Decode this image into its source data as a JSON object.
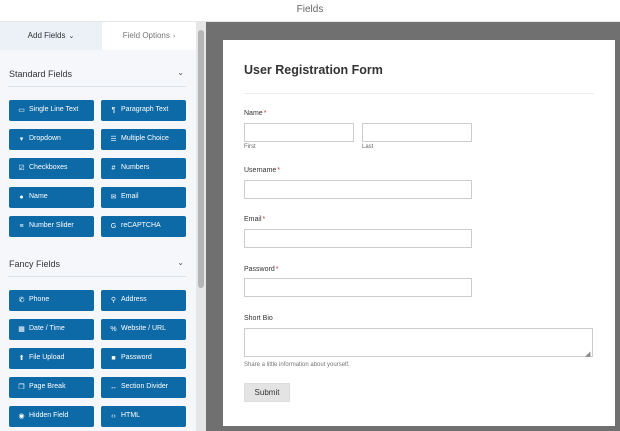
{
  "topbar": {
    "title": "Fields"
  },
  "tabs": {
    "add_fields": "Add Fields",
    "field_options": "Field Options"
  },
  "standard_section": {
    "title": "Standard Fields",
    "buttons": [
      {
        "icon": "single-line-text-icon",
        "label": "Single Line Text"
      },
      {
        "icon": "paragraph-text-icon",
        "label": "Paragraph Text"
      },
      {
        "icon": "dropdown-icon",
        "label": "Dropdown"
      },
      {
        "icon": "multiple-choice-icon",
        "label": "Multiple Choice"
      },
      {
        "icon": "checkboxes-icon",
        "label": "Checkboxes"
      },
      {
        "icon": "numbers-icon",
        "label": "Numbers"
      },
      {
        "icon": "name-icon",
        "label": "Name"
      },
      {
        "icon": "email-icon",
        "label": "Email"
      },
      {
        "icon": "number-slider-icon",
        "label": "Number Slider"
      },
      {
        "icon": "recaptcha-icon",
        "label": "reCAPTCHA"
      }
    ]
  },
  "fancy_section": {
    "title": "Fancy Fields",
    "buttons": [
      {
        "icon": "phone-icon",
        "label": "Phone"
      },
      {
        "icon": "address-icon",
        "label": "Address"
      },
      {
        "icon": "date-time-icon",
        "label": "Date / Time"
      },
      {
        "icon": "website-url-icon",
        "label": "Website / URL"
      },
      {
        "icon": "file-upload-icon",
        "label": "File Upload"
      },
      {
        "icon": "password-icon",
        "label": "Password"
      },
      {
        "icon": "page-break-icon",
        "label": "Page Break"
      },
      {
        "icon": "section-divider-icon",
        "label": "Section Divider"
      },
      {
        "icon": "hidden-field-icon",
        "label": "Hidden Field"
      },
      {
        "icon": "html-icon",
        "label": "HTML"
      }
    ]
  },
  "form": {
    "title": "User Registration Form",
    "required_mark": "*",
    "name_label": "Name",
    "first_sublabel": "First",
    "last_sublabel": "Last",
    "username_label": "Username",
    "email_label": "Email",
    "password_label": "Password",
    "bio_label": "Short Bio",
    "bio_description": "Share a little information about yourself.",
    "submit_label": "Submit"
  },
  "colors": {
    "field_button": "#0e6aa6",
    "preview_bg": "#707070",
    "required": "#c0392b"
  }
}
